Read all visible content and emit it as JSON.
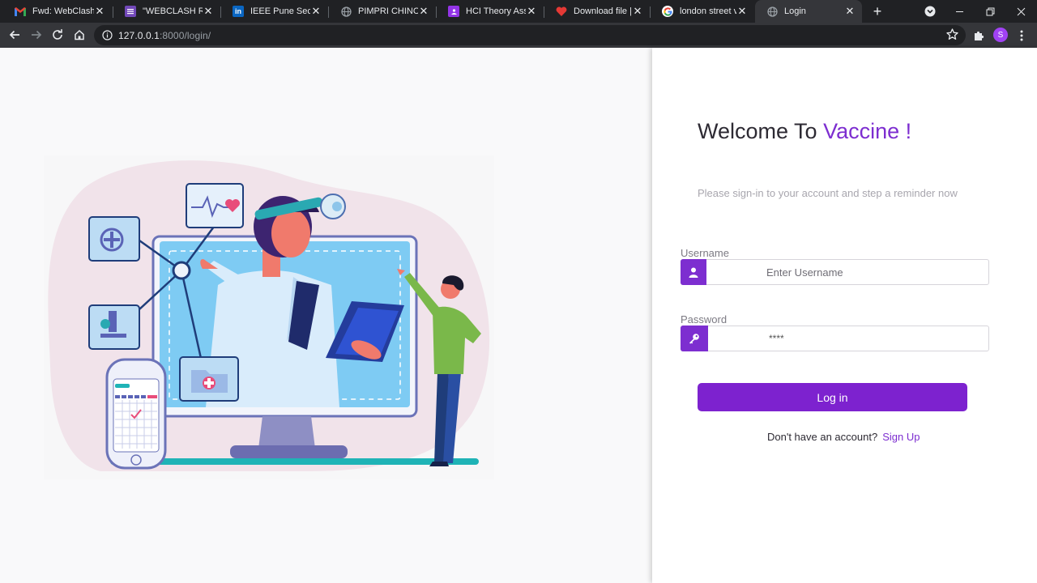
{
  "browser": {
    "tabs": [
      {
        "title": "Fwd: WebClash: Fi",
        "favicon": "gmail-icon",
        "favicon_color": "#ea4335"
      },
      {
        "title": "\"WEBCLASH REGI",
        "favicon": "forms-icon",
        "favicon_color": "#7248b9"
      },
      {
        "title": "IEEE Pune Section",
        "favicon": "linkedin-icon",
        "favicon_color": "#0a66c2"
      },
      {
        "title": "PIMPRI CHINCHW",
        "favicon": "globe-icon",
        "favicon_color": "#9aa0a6"
      },
      {
        "title": "HCI Theory Assig",
        "favicon": "classroom-icon",
        "favicon_color": "#9334e6"
      },
      {
        "title": "Download file | iL",
        "favicon": "heart-icon",
        "favicon_color": "#e53935"
      },
      {
        "title": "london street vie",
        "favicon": "google-icon",
        "favicon_color": "#ffffff"
      },
      {
        "title": "Login",
        "favicon": "globe-icon",
        "favicon_color": "#9aa0a6",
        "active": true
      }
    ],
    "url_host": "127.0.0.1",
    "url_rest": ":8000/login/",
    "profile_initial": "S"
  },
  "login": {
    "welcome_prefix": "Welcome To ",
    "welcome_accent": "Vaccine !",
    "subtitle": "Please sign-in to your account and step a reminder now",
    "username_label": "Username",
    "username_placeholder": "Enter Username",
    "password_label": "Password",
    "password_value": "****",
    "login_button": "Log in",
    "signup_prompt": "Don't have an account?",
    "signup_link": "Sign Up"
  },
  "colors": {
    "accent": "#7d2ed0",
    "button": "#7d22cf",
    "chrome_dark": "#202124",
    "chrome_toolbar": "#35363a"
  }
}
